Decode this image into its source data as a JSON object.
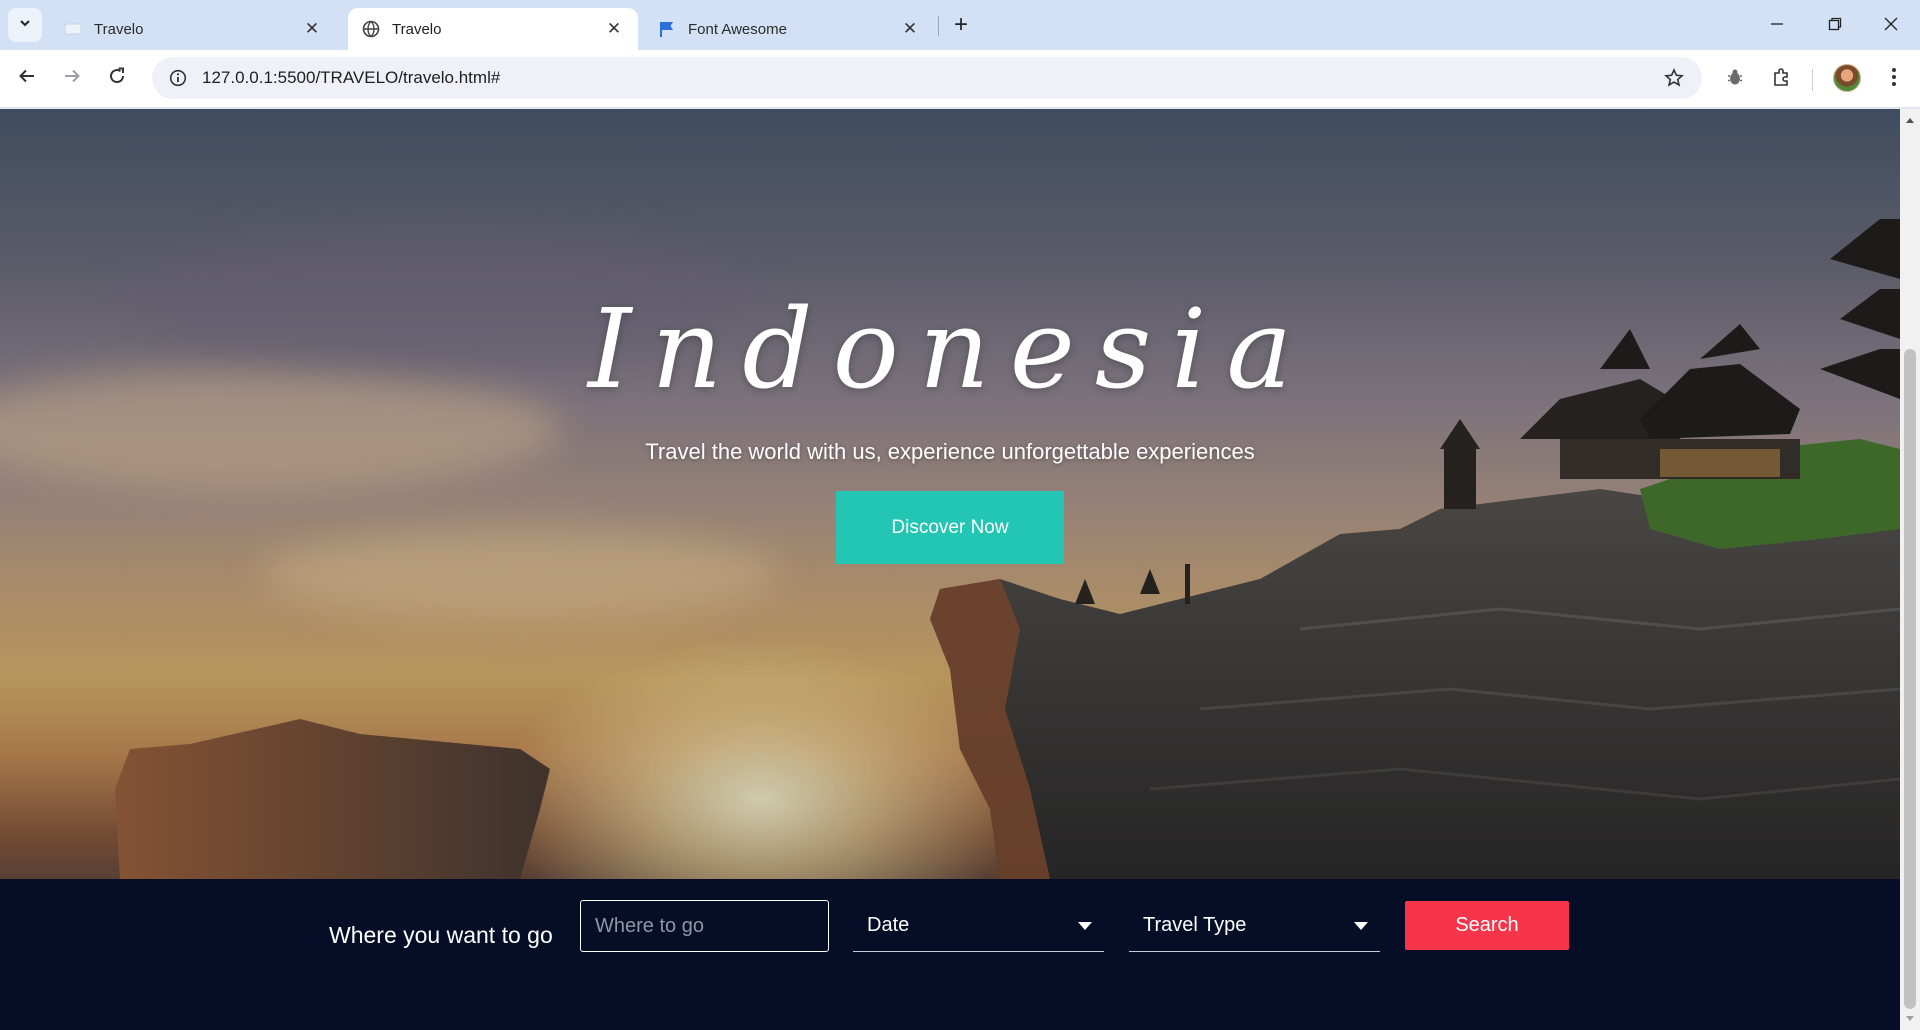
{
  "browser": {
    "tabs": [
      {
        "title": "Travelo",
        "state": "inactive"
      },
      {
        "title": "Travelo",
        "state": "active"
      },
      {
        "title": "Font Awesome",
        "state": "inactive"
      }
    ],
    "tab_close_glyph": "✕",
    "new_tab_glyph": "+",
    "window_controls": {
      "minimize": "—",
      "restore": "❐",
      "close": "✕"
    },
    "address": "127.0.0.1:5500/TRAVELO/travelo.html#",
    "icons": [
      "chevron-down-icon",
      "globe-icon",
      "flag-icon",
      "back-icon",
      "forward-icon",
      "reload-icon",
      "info-icon",
      "star-icon",
      "bug-icon",
      "puzzle-icon",
      "kebab-menu-icon"
    ]
  },
  "hero": {
    "title": "Indonesia",
    "subtitle": "Travel the world with us, experience unforgettable experiences",
    "cta_label": "Discover Now"
  },
  "search": {
    "label": "Where you want to go",
    "destination_placeholder": "Where to go",
    "date_label": "Date",
    "type_label": "Travel Type",
    "button_label": "Search"
  },
  "colors": {
    "accent_teal": "#22c6b2",
    "search_red": "#f7354a",
    "search_bar_bg": "#060d26",
    "chrome_tabstrip": "#d3e1f6"
  }
}
